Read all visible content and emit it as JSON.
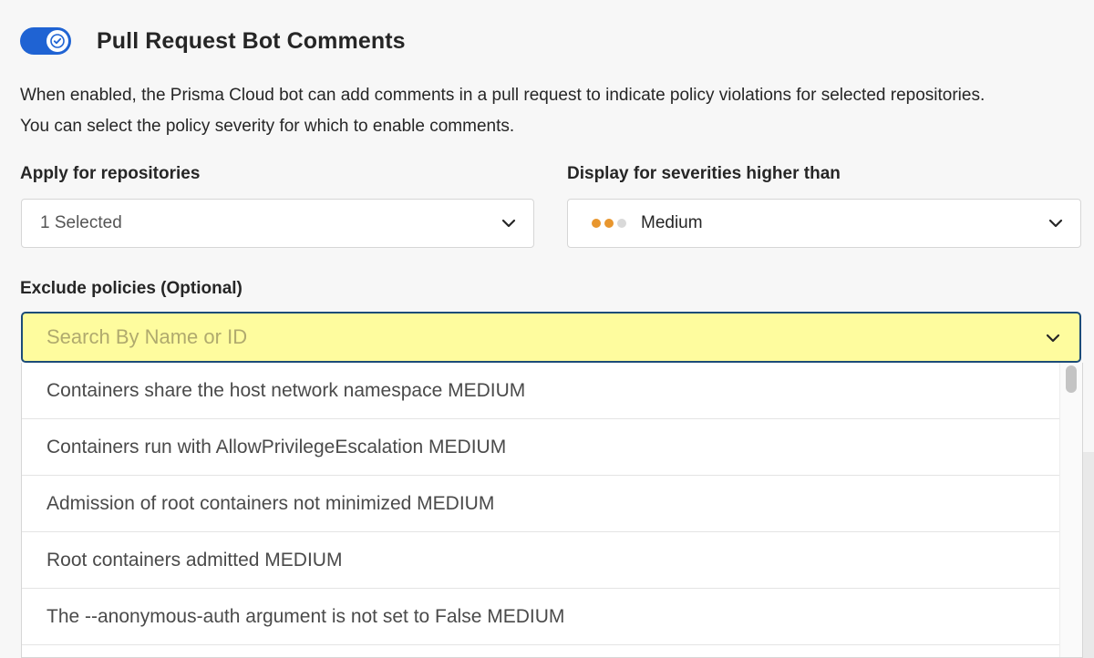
{
  "header": {
    "title": "Pull Request Bot Comments",
    "toggle_enabled": true,
    "toggle_color": "#1f63d3"
  },
  "description": {
    "line1": "When enabled, the Prisma Cloud bot can add comments in a pull request to indicate policy violations for selected repositories.",
    "line2": "You can select the policy severity for which to enable comments."
  },
  "repositories": {
    "label": "Apply for repositories",
    "value": "1 Selected"
  },
  "severity": {
    "label": "Display for severities higher than",
    "value": "Medium",
    "dot_colors": [
      "#e8962e",
      "#e8962e",
      "#d9d9d9"
    ]
  },
  "exclude": {
    "label": "Exclude policies (Optional)",
    "placeholder": "Search By Name or ID",
    "highlight_color": "#fefc9e",
    "options": [
      "Containers share the host network namespace MEDIUM",
      "Containers run with AllowPrivilegeEscalation MEDIUM",
      "Admission of root containers not minimized MEDIUM",
      "Root containers admitted MEDIUM",
      "The --anonymous-auth argument is not set to False MEDIUM"
    ]
  }
}
